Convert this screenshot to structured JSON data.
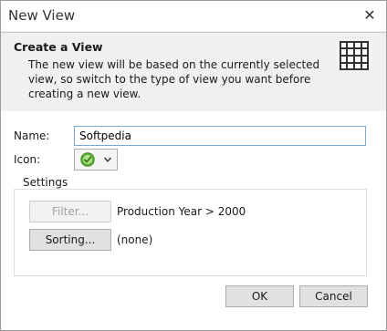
{
  "window": {
    "title": "New View",
    "close_label": "✕"
  },
  "header": {
    "title": "Create a View",
    "description": "The new view will be based on the currently selected view, so switch to the type of view you want before creating a new view."
  },
  "form": {
    "name_label": "Name:",
    "name_value": "Softpedia",
    "icon_label": "Icon:"
  },
  "settings": {
    "legend": "Settings",
    "filter_button": "Filter...",
    "filter_value": "Production Year > 2000",
    "sorting_button": "Sorting...",
    "sorting_value": "(none)"
  },
  "buttons": {
    "ok": "OK",
    "cancel": "Cancel"
  },
  "colors": {
    "accent": "#7aa7d8",
    "check_green": "#5fb236"
  }
}
